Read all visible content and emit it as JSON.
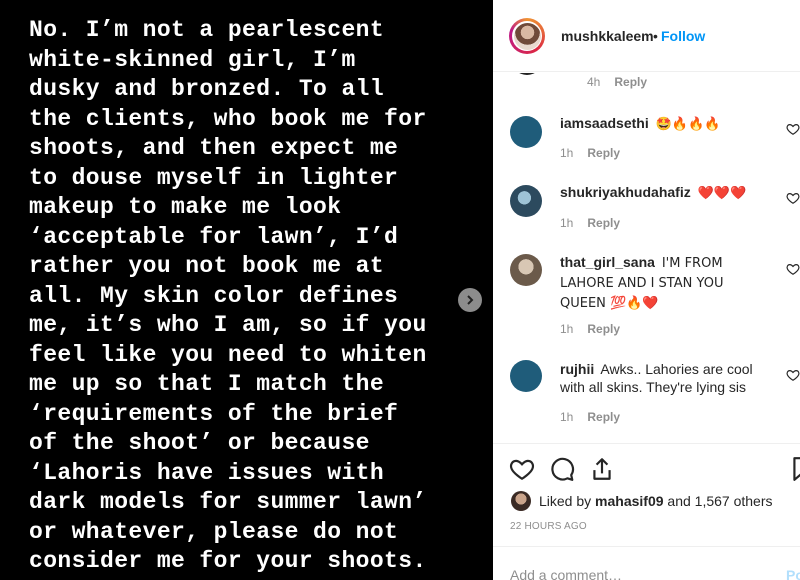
{
  "post": {
    "text_lines": [
      "No. I’m not a pearlescent",
      "white-skinned girl, I’m",
      "dusky and bronzed. To all",
      "the clients, who book me for",
      "shoots, and then expect me",
      "to douse myself in lighter",
      "makeup to make me look",
      "‘acceptable for lawn’, I’d",
      "rather you not book me at",
      "all. My skin color defines",
      "me, it’s who I am, so if you",
      "feel like you need to whiten",
      "me up so that I match the",
      "‘requirements of the brief",
      "of the shoot’ or because",
      "‘Lahoris have issues with",
      "dark models for summer lawn’",
      "or whatever, please do not",
      "consider me for your shoots.",
      "                          ’"
    ]
  },
  "header": {
    "username": "mushkkaleem",
    "dot": "•",
    "follow_label": "Follow"
  },
  "comments": {
    "top_meta": {
      "time": "4h",
      "reply": "Reply"
    },
    "items": [
      {
        "username": "iamsaadsethi",
        "text": "🤩🔥🔥🔥",
        "time": "1h",
        "reply": "Reply",
        "avatar_color": "#1f5c7a"
      },
      {
        "username": "shukriyakhudahafiz",
        "text": "❤️❤️❤️",
        "time": "1h",
        "reply": "Reply",
        "avatar_color": "#2c4a5e"
      },
      {
        "username": "that_girl_sana",
        "text": "I'M FROM LAHORE AND I STAN YOU QUEEN 💯🔥❤️",
        "time": "1h",
        "reply": "Reply",
        "avatar_color": "#6b5a4a"
      },
      {
        "username": "rujhii",
        "text": "Awks.. Lahories are cool with all skins. They're lying sis",
        "time": "1h",
        "reply": "Reply",
        "avatar_color": "#1f5c7a"
      }
    ]
  },
  "likes": {
    "prefix": "Liked by",
    "user": "mahasif09",
    "suffix": "and 1,567 others"
  },
  "timestamp": "22 HOURS AGO",
  "add_comment": {
    "placeholder": "Add a comment…",
    "post_label": "Post"
  },
  "icons": [
    "chevron-right-icon",
    "heart-icon",
    "comment-icon",
    "share-icon",
    "bookmark-icon"
  ],
  "colors": {
    "accent": "#0095f6",
    "text": "#262626",
    "muted": "#8e8e8e"
  }
}
